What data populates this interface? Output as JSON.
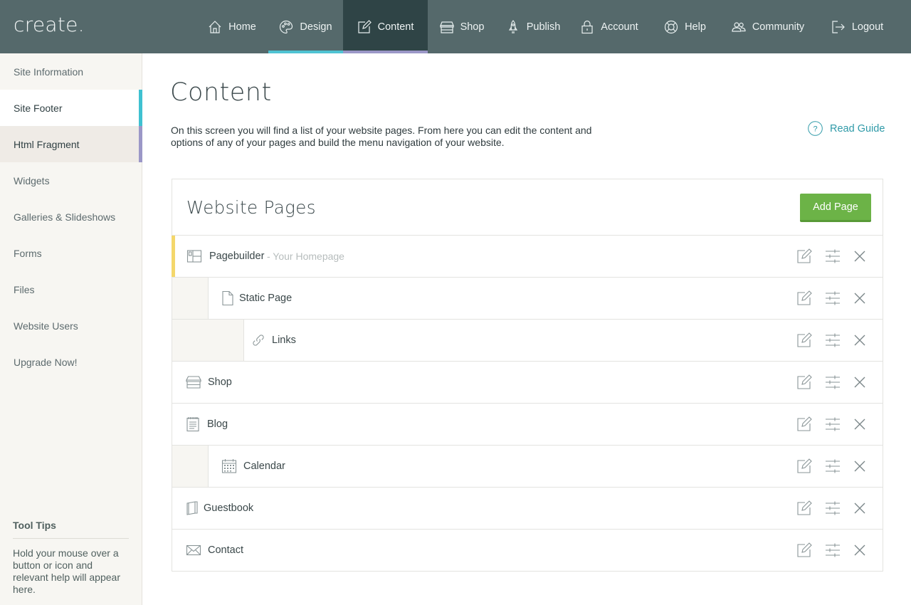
{
  "app": {
    "logo": "create.",
    "colors": {
      "topbar": "#55696b",
      "active_tab": "#2f4446",
      "design_underline": "#4fc3d3",
      "content_underline": "#9b97c7",
      "add_button": "#6cb347",
      "homepage_accent": "#f4d76b",
      "link": "#2f9aa8"
    }
  },
  "nav": [
    {
      "label": "Home",
      "icon": "home-icon"
    },
    {
      "label": "Design",
      "icon": "palette-icon"
    },
    {
      "label": "Content",
      "icon": "edit-icon",
      "active": true
    },
    {
      "label": "Shop",
      "icon": "shop-icon"
    },
    {
      "label": "Publish",
      "icon": "rocket-icon"
    },
    {
      "label": "Account",
      "icon": "lock-icon"
    },
    {
      "label": "Help",
      "icon": "lifebuoy-icon"
    },
    {
      "label": "Community",
      "icon": "people-icon"
    },
    {
      "label": "Logout",
      "icon": "logout-icon"
    }
  ],
  "sidebar": {
    "items": [
      {
        "label": "Site Information"
      },
      {
        "label": "Site Footer"
      },
      {
        "label": "Html Fragment"
      },
      {
        "label": "Widgets"
      },
      {
        "label": "Galleries & Slideshows"
      },
      {
        "label": "Forms"
      },
      {
        "label": "Files"
      },
      {
        "label": "Website Users"
      },
      {
        "label": "Upgrade Now!"
      }
    ],
    "tooltips": {
      "title": "Tool Tips",
      "text": "Hold your mouse over a button or icon and relevant help will appear here."
    }
  },
  "main": {
    "title": "Content",
    "intro": "On this screen you will find a list of your website pages. From here you can edit the content and options of any of your pages and build the menu navigation of your website.",
    "guide_label": "Read Guide"
  },
  "pages_panel": {
    "title": "Website Pages",
    "add_label": "Add Page",
    "rows": [
      {
        "label": "Pagebuilder",
        "sub": "- Your Homepage",
        "icon": "layout-icon",
        "level": 0
      },
      {
        "label": "Static Page",
        "icon": "document-icon",
        "level": 1
      },
      {
        "label": "Links",
        "icon": "link-icon",
        "level": 2
      },
      {
        "label": "Shop",
        "icon": "shop-icon",
        "level": 0
      },
      {
        "label": "Blog",
        "icon": "blog-icon",
        "level": 0
      },
      {
        "label": "Calendar",
        "icon": "calendar-icon",
        "level": 1
      },
      {
        "label": "Guestbook",
        "icon": "book-icon",
        "level": 0
      },
      {
        "label": "Contact",
        "icon": "envelope-icon",
        "level": 0
      }
    ],
    "row_actions": [
      "edit-icon",
      "settings-sliders-icon",
      "delete-icon"
    ]
  }
}
